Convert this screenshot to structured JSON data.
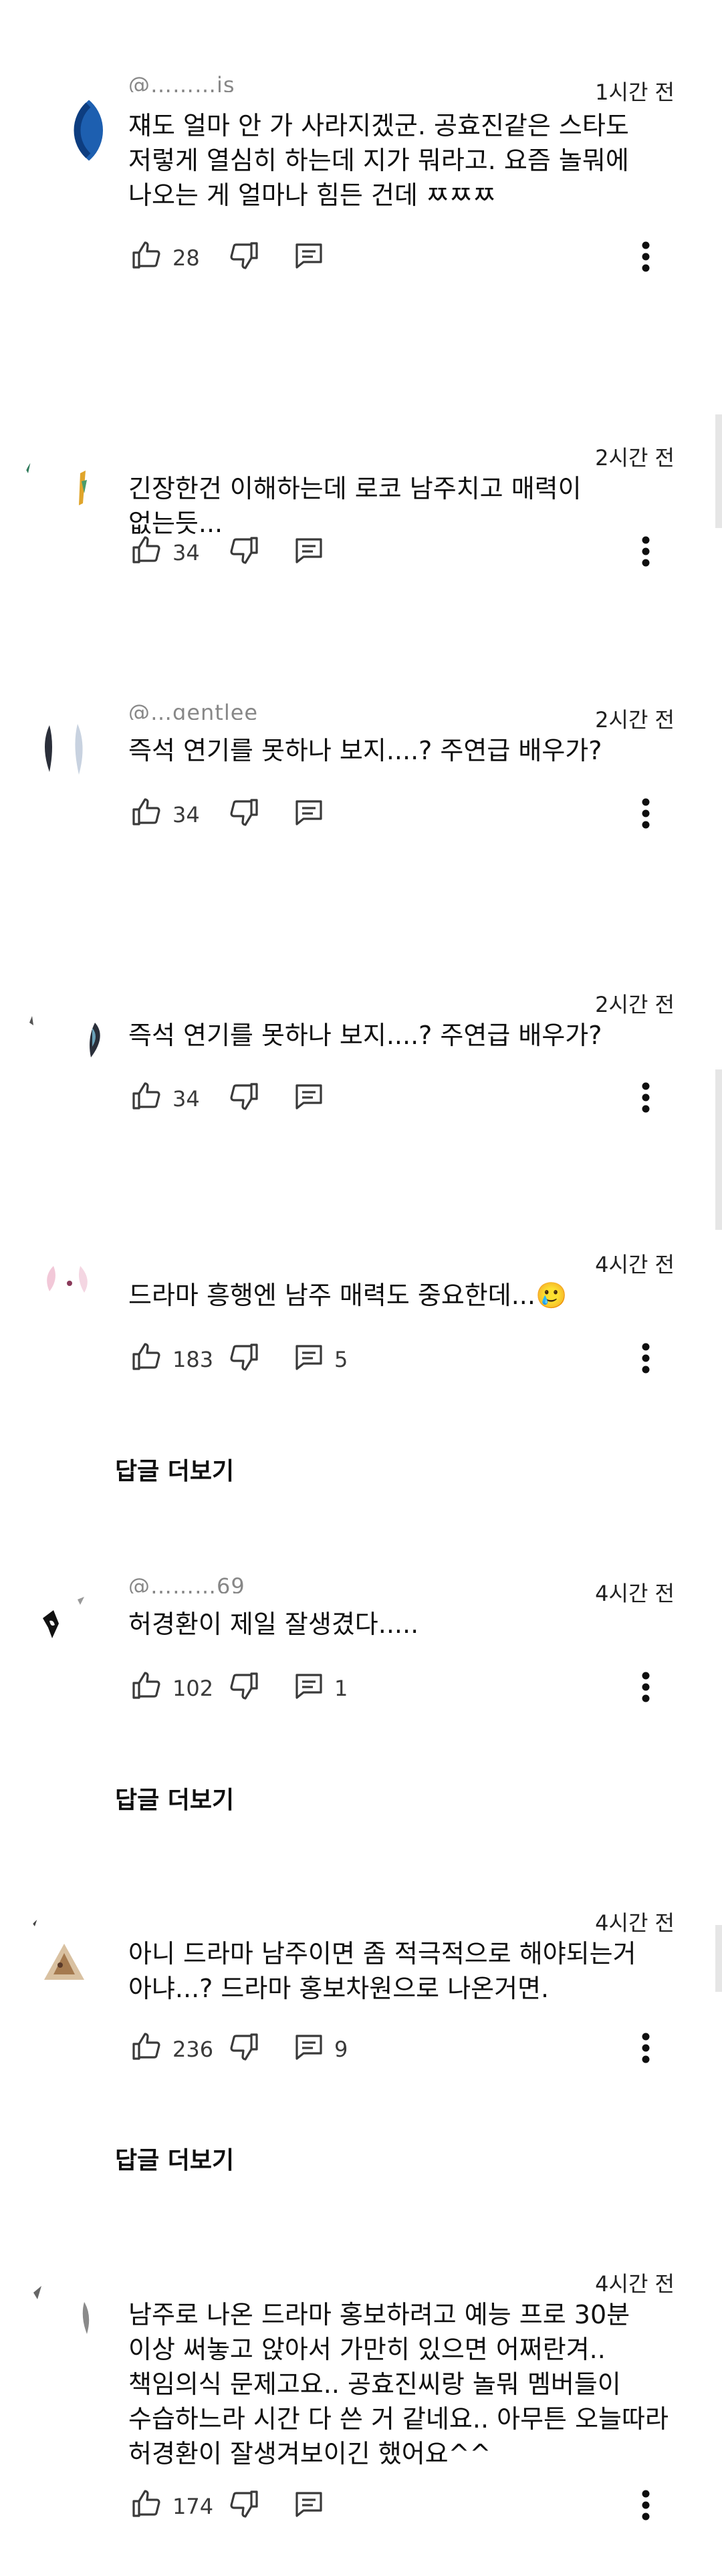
{
  "comments": [
    {
      "handle": "@………js",
      "time": "1시간 전",
      "text": "쟤도 얼마 안 가 사라지겠군. 공효진같은 스타도 저렇게 열심히 하는데 지가 뭐라고. 요즘 놀뭐에 나오는 게 얼마나 힘든 건데 ㅉㅉㅉ",
      "likes": "28",
      "replies": "",
      "more_replies": ""
    },
    {
      "handle": "",
      "time": "2시간 전",
      "text": "긴장한건 이해하는데 로코 남주치고 매력이 없는듯...",
      "likes": "34",
      "replies": "",
      "more_replies": ""
    },
    {
      "handle": "@…gentlee",
      "time": "2시간 전",
      "text": "즉석 연기를 못하나 보지....? 주연급 배우가?",
      "likes": "34",
      "replies": "",
      "more_replies": ""
    },
    {
      "handle": "",
      "time": "2시간 전",
      "text": "즉석 연기를 못하나 보지....? 주연급 배우가?",
      "likes": "34",
      "replies": "",
      "more_replies": ""
    },
    {
      "handle": "",
      "time": "4시간 전",
      "text": "드라마 흥행엔 남주 매력도 중요한데...🥲",
      "likes": "183",
      "replies": "5",
      "more_replies": "답글 더보기"
    },
    {
      "handle": "@………69",
      "time": "4시간 전",
      "text": "허경환이 제일 잘생겼다.....",
      "likes": "102",
      "replies": "1",
      "more_replies": "답글 더보기"
    },
    {
      "handle": "",
      "time": "4시간 전",
      "text": "아니 드라마 남주이면 좀 적극적으로 해야되는거 아냐...? 드라마 홍보차원으로 나온거면.",
      "likes": "236",
      "replies": "9",
      "more_replies": "답글 더보기"
    },
    {
      "handle": "",
      "time": "4시간 전",
      "text": "남주로 나온 드라마 홍보하려고 예능 프로 30분 이상 써놓고 앉아서 가만히 있으면 어쩌란겨.. 책임의식 문제고요.. 공효진씨랑 놀뭐 멤버들이 수습하느라 시간 다 쓴 거 같네요.. 아무튼 오늘따라 허경환이 잘생겨보이긴 했어요^^",
      "likes": "174",
      "replies": "",
      "more_replies": ""
    }
  ],
  "icons": {
    "like": "thumb-up-icon",
    "dislike": "thumb-down-icon",
    "reply": "comment-icon",
    "more": "more-vertical-icon"
  },
  "colors": {
    "text": "#0f0f0f",
    "secondary": "#606060",
    "icon": "#3a3a3a",
    "background": "#ffffff"
  }
}
